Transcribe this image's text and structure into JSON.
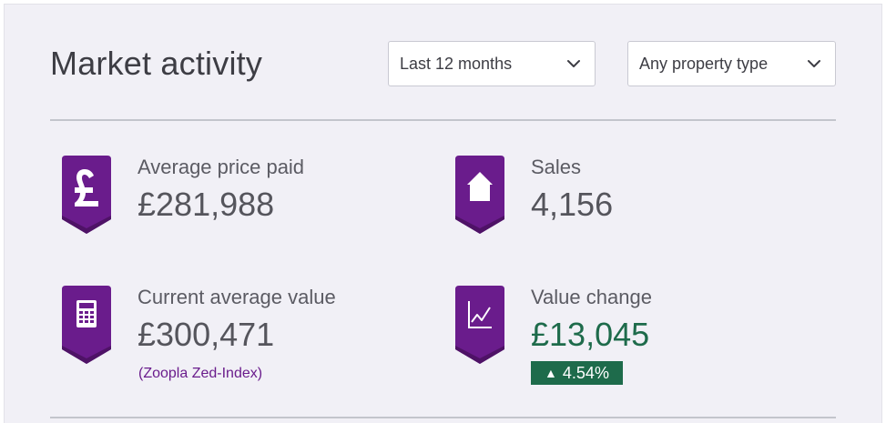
{
  "header": {
    "title": "Market activity"
  },
  "filters": {
    "period": {
      "selected": "Last 12 months"
    },
    "property_type": {
      "selected": "Any property type"
    }
  },
  "stats": {
    "average_price_paid": {
      "label": "Average price paid",
      "value": "£281,988",
      "icon": "pound-icon"
    },
    "sales": {
      "label": "Sales",
      "value": "4,156",
      "icon": "house-icon"
    },
    "current_average_value": {
      "label": "Current average value",
      "value": "£300,471",
      "icon": "calculator-icon",
      "note": "(Zoopla Zed-Index)"
    },
    "value_change": {
      "label": "Value change",
      "value": "£13,045",
      "icon": "line-chart-icon",
      "change": "4.54%",
      "change_symbol": "▲"
    }
  },
  "colors": {
    "accent_purple": "#6a1c8c",
    "positive_green": "#1e6b4b",
    "panel_bg": "#f1f0f6"
  }
}
